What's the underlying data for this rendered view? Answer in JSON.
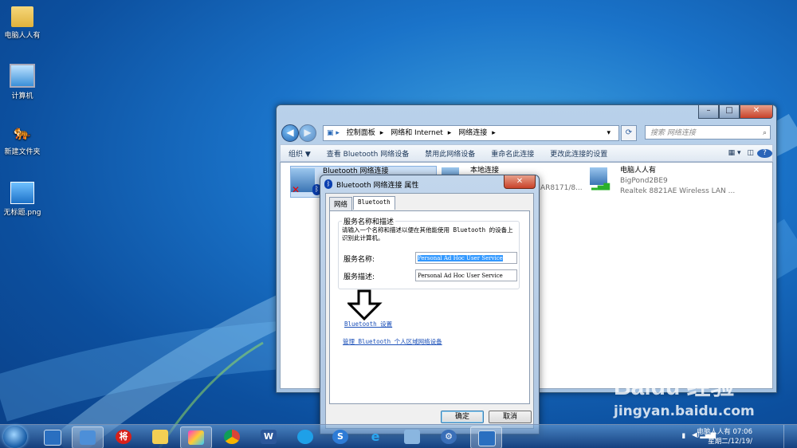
{
  "desktop": {
    "icons": [
      {
        "label": "电脑人人有",
        "icon": "user-folder-icon"
      },
      {
        "label": "计算机",
        "icon": "computer-icon"
      },
      {
        "label": "新建文件夹",
        "icon": "tiger-folder-icon"
      },
      {
        "label": "无标题.png",
        "icon": "image-file-icon"
      }
    ]
  },
  "explorer": {
    "breadcrumb": [
      "控制面板",
      "网络和 Internet",
      "网络连接"
    ],
    "search_placeholder": "搜索 网络连接",
    "toolbar": [
      "组织 ▼",
      "查看 Bluetooth 网络设备",
      "禁用此网络设备",
      "重命名此连接",
      "更改此连接的设置"
    ],
    "connections": [
      {
        "name": "Bluetooth 网络连接",
        "line2": "",
        "line3": "",
        "selected": true
      },
      {
        "name": "本地连接",
        "line2": "",
        "line3": "AR8171/8..."
      },
      {
        "name": "电脑人人有",
        "line2": "BigPond2BE9",
        "line3": "Realtek 8821AE Wireless LAN ..."
      }
    ]
  },
  "dialog": {
    "title": "Bluetooth 网络连接 属性",
    "close": "✕",
    "tabs": [
      "网络",
      "Bluetooth"
    ],
    "group_title": "服务名称和描述",
    "description": "请输入一个名称和描述以便在其他能使用 Bluetooth 的设备上识别此计算机。",
    "service_name_label": "服务名称:",
    "service_name_value": "Personal Ad Hoc User Service",
    "description_label": "服务描述:",
    "description_value": "Personal Ad Hoc User Service",
    "link_settings": "Bluetooth 设置",
    "link_manage": "管理 Bluetooth 个人区域网络设备",
    "ok": "确定",
    "cancel": "取消"
  },
  "taskbar": {
    "apps": [
      "computer",
      "control-panel",
      "jiang",
      "folder",
      "paint",
      "chrome",
      "word",
      "edge-blue",
      "sogou",
      "ie",
      "explorer-pinned",
      "bluetooth-app",
      "monitor"
    ],
    "jiang_label": "将",
    "clock_line1": "电脑人人有 07:06",
    "clock_line2": "星期二/12/19/"
  },
  "watermark": {
    "brand": "Baidu 经验",
    "url": "jingyan.baidu.com"
  }
}
